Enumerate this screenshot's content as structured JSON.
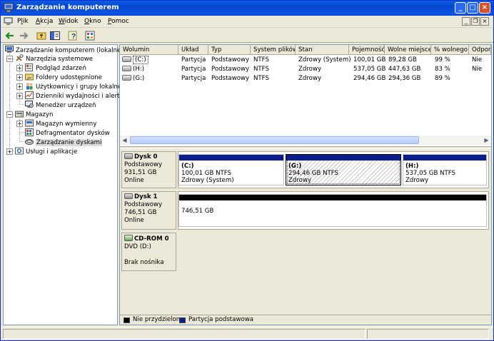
{
  "window": {
    "title": "Zarządzanie komputerem"
  },
  "menu": {
    "items": [
      "Plik",
      "Akcja",
      "Widok",
      "Okno",
      "Pomoc"
    ],
    "underline_index": [
      1,
      0,
      0,
      0,
      0
    ]
  },
  "tree": {
    "root": "Zarządzanie komputerem (lokalne)",
    "system_tools": "Narzędzia systemowe",
    "event_viewer": "Podgląd zdarzeń",
    "shared_folders": "Foldery udostępnione",
    "local_users": "Użytkownicy i grupy lokalne",
    "perf_logs": "Dzienniki wydajności i alerty",
    "device_manager": "Menedżer urządzeń",
    "storage": "Magazyn",
    "removable_storage": "Magazyn wymienny",
    "defrag": "Defragmentator dysków",
    "disk_mgmt": "Zarządzanie dyskami",
    "services": "Usługi i aplikacje"
  },
  "columns": [
    "Wolumin",
    "Układ",
    "Typ",
    "System plików",
    "Stan",
    "Pojemność",
    "Wolne miejsce",
    "% wolnego",
    "Odporn"
  ],
  "volumes": [
    {
      "name": "(C:)",
      "layout": "Partycja",
      "type": "Podstawowy",
      "fs": "NTFS",
      "status": "Zdrowy (System)",
      "capacity": "100,01 GB",
      "free": "89,28 GB",
      "pct": "99 %",
      "fault": "Nie"
    },
    {
      "name": "(H:)",
      "layout": "Partycja",
      "type": "Podstawowy",
      "fs": "NTFS",
      "status": "Zdrowy",
      "capacity": "537,05 GB",
      "free": "447,63 GB",
      "pct": "83 %",
      "fault": "Nie"
    },
    {
      "name": "(G:)",
      "layout": "Partycja",
      "type": "Podstawowy",
      "fs": "NTFS",
      "status": "Zdrowy",
      "capacity": "294,46 GB",
      "free": "294,36 GB",
      "pct": "89 %",
      "fault": ""
    }
  ],
  "disks": {
    "disk0": {
      "name": "Dysk 0",
      "kind": "Podstawowy",
      "size": "931,51 GB",
      "state": "Online",
      "parts": [
        {
          "name": "(C:)",
          "size": "100,01 GB NTFS",
          "status": "Zdrowy (System)"
        },
        {
          "name": "(G:)",
          "size": "294,46 GB NTFS",
          "status": "Zdrowy"
        },
        {
          "name": "(H:)",
          "size": "537,05 GB NTFS",
          "status": "Zdrowy"
        }
      ]
    },
    "disk1": {
      "name": "Dysk 1",
      "kind": "Podstawowy",
      "size": "746,51 GB",
      "state": "Online",
      "unalloc": "746,51 GB"
    },
    "cdrom0": {
      "name": "CD-ROM 0",
      "kind": "DVD (D:)",
      "state": "Brak nośnika"
    }
  },
  "legend": {
    "unallocated": "Nie przydzielone",
    "primary": "Partycja podstawowa"
  },
  "colors": {
    "primary": "#0a1e8c",
    "unallocated": "#000000",
    "titlebar": "#0545d0"
  }
}
